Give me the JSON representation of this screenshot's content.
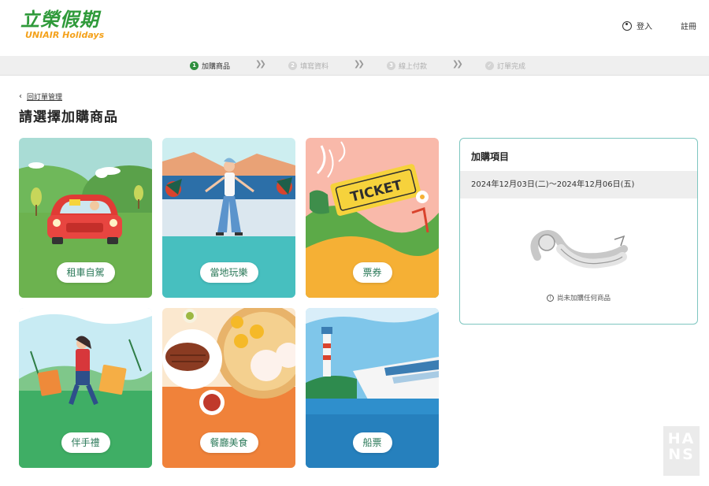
{
  "brand": {
    "name_zh": "立榮假期",
    "name_en": "UNIAIR Holidays"
  },
  "header": {
    "login_label": "登入",
    "register_label": "註冊"
  },
  "stepper": {
    "steps": [
      {
        "num": "1",
        "label": "加購商品",
        "active": true
      },
      {
        "num": "2",
        "label": "填寫資料",
        "active": false
      },
      {
        "num": "3",
        "label": "線上付款",
        "active": false
      },
      {
        "num": "✓",
        "label": "訂單完成",
        "active": false
      }
    ]
  },
  "back_link": {
    "label": "回訂單管理"
  },
  "page_title": "請選擇加購商品",
  "cards": [
    {
      "label": "租車自駕"
    },
    {
      "label": "當地玩樂"
    },
    {
      "label": "票券"
    },
    {
      "label": "伴手禮"
    },
    {
      "label": "餐廳美食"
    },
    {
      "label": "船票"
    }
  ],
  "ticket_text": "TICKET",
  "panel": {
    "title": "加購項目",
    "date_range": "2024年12月03日(二)～2024年12月06日(五)",
    "empty_message": "尚未加購任何商品"
  },
  "watermark": {
    "line1": "HA",
    "line2": "NS"
  },
  "colors": {
    "brand_green": "#2f9a3a",
    "brand_orange": "#f4a11a",
    "panel_border": "#7ec6c0",
    "button_text": "#2c7a5a"
  }
}
